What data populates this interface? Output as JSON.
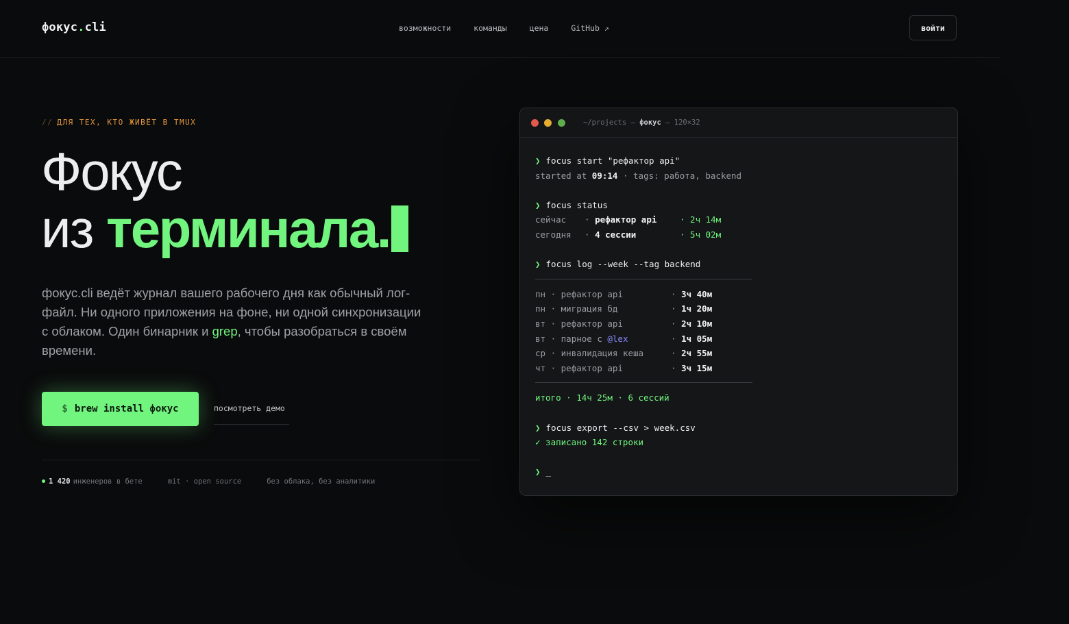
{
  "header": {
    "logo_main": "фокус",
    "logo_dot": ".",
    "logo_ext": "cli",
    "nav": [
      "возможности",
      "команды",
      "цена",
      "GitHub ↗"
    ],
    "login_label": "войти"
  },
  "hero": {
    "eyebrow_slashes": "//",
    "eyebrow": "ДЛЯ ТЕХ, КТО ЖИВЁТ В TMUX",
    "title_line1": "Фокус",
    "title_line2_plain": "из ",
    "title_line2_accent": "терминала.",
    "lead_part1": "фокус.cli ведёт журнал вашего рабочего дня как обычный лог-файл. Ни одного приложения на фоне, ни одной синхронизации с облаком. Один бинарник и ",
    "lead_accent": "grep",
    "lead_part2": ", чтобы разобраться в своём времени.",
    "cta_dollar": "$",
    "cta_label": "brew install фокус",
    "demo_label": "посмотреть демо"
  },
  "stats": {
    "users_count": "1 420",
    "users_label": "инженеров в бете",
    "license": "mit · open source",
    "privacy": "без облака, без аналитики"
  },
  "terminal": {
    "title_path": "~/projects — ",
    "title_name": "фокус",
    "title_size": " — 120×32",
    "prompt": "❯",
    "cmd1": "focus start \"рефактор api\"",
    "out1_prefix": "started at ",
    "out1_time": "09:14",
    "out1_suffix": " · tags: работа, backend",
    "cmd2": "focus status",
    "status": [
      {
        "key": "сейчас",
        "value": "рефактор api",
        "time": "· 2ч 14м"
      },
      {
        "key": "сегодня",
        "value": "4 сессии",
        "time": "· 5ч 02м"
      }
    ],
    "cmd3": "focus log --week --tag backend",
    "log": [
      {
        "day": "пн",
        "task": "рефактор api",
        "time": "3ч 40м"
      },
      {
        "day": "пн",
        "task": "миграция бд",
        "time": "1ч 20м"
      },
      {
        "day": "вт",
        "task": "рефактор api",
        "time": "2ч 10м"
      },
      {
        "day": "вт",
        "task": "парное с ",
        "mention": "@lex",
        "time": "1ч 05м"
      },
      {
        "day": "ср",
        "task": "инвалидация кеша",
        "time": "2ч 55м"
      },
      {
        "day": "чт",
        "task": "рефактор api",
        "time": "3ч 15м"
      }
    ],
    "total": "итого · 14ч 25м · 6 сессий",
    "cmd4": "focus export --csv > week.csv",
    "out4": "✓ записано 142 строки",
    "cursor": "_"
  },
  "colors": {
    "accent": "#72f57e",
    "eyebrow": "#e89a3c",
    "background": "#0a0b0c",
    "terminal_bg": "#141618",
    "mention": "#8a8cff"
  }
}
